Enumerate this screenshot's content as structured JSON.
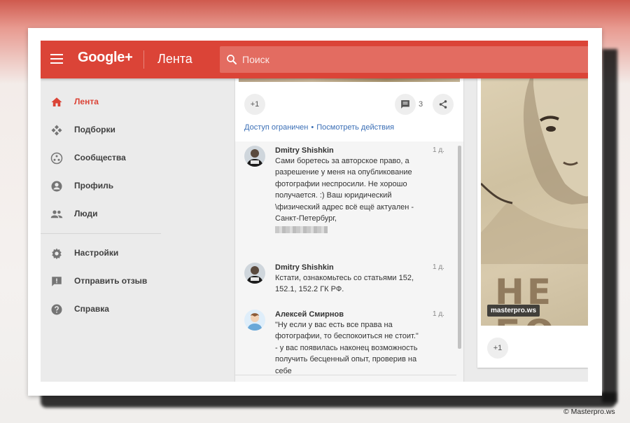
{
  "header": {
    "logo": "Google+",
    "section": "Лента",
    "search_placeholder": "Поиск"
  },
  "sidebar": {
    "items": [
      {
        "label": "Лента",
        "icon": "home-icon",
        "active": true
      },
      {
        "label": "Подборки",
        "icon": "collections-icon",
        "active": false
      },
      {
        "label": "Сообщества",
        "icon": "communities-icon",
        "active": false
      },
      {
        "label": "Профиль",
        "icon": "profile-icon",
        "active": false
      },
      {
        "label": "Люди",
        "icon": "people-icon",
        "active": false
      },
      {
        "label": "Настройки",
        "icon": "settings-icon",
        "active": false
      },
      {
        "label": "Отправить отзыв",
        "icon": "feedback-icon",
        "active": false
      },
      {
        "label": "Справка",
        "icon": "help-icon",
        "active": false
      }
    ]
  },
  "post": {
    "plus_label": "+1",
    "comment_count": "3",
    "access_label": "Доступ ограничен",
    "separator": "•",
    "view_activity_label": "Посмотреть действия",
    "comments": [
      {
        "author": "Dmitry Shishkin",
        "time": "1 д.",
        "text": "Сами боретесь за авторское право, а разрешение у меня на опубликование фотографии неспросили. Не хорошо получается. :) Ваш юридический \\физический адрес всё ещё актуален - Санкт-Петербург,"
      },
      {
        "author": "Dmitry Shishkin",
        "time": "1 д.",
        "text": "Кстати, ознакомьтесь со статьями 152, 152.1, 152.2 ГК РФ."
      },
      {
        "author": "Алексей Смирнов",
        "time": "1 д.",
        "text": "\"Ну если у вас есть все права на фотографии, то беспокоиться не стоит.\" - у вас появилась наконец возможность получить бесценный опыт, проверив на себе"
      }
    ]
  },
  "right_card": {
    "poster_text": "НЕ БО",
    "watermark": "masterpro.ws",
    "plus_label": "+1"
  },
  "credit": "© Masterpro.ws",
  "colors": {
    "brand_red": "#db4437",
    "search_bg": "#e36c61",
    "link_blue": "#3b6fb6"
  }
}
